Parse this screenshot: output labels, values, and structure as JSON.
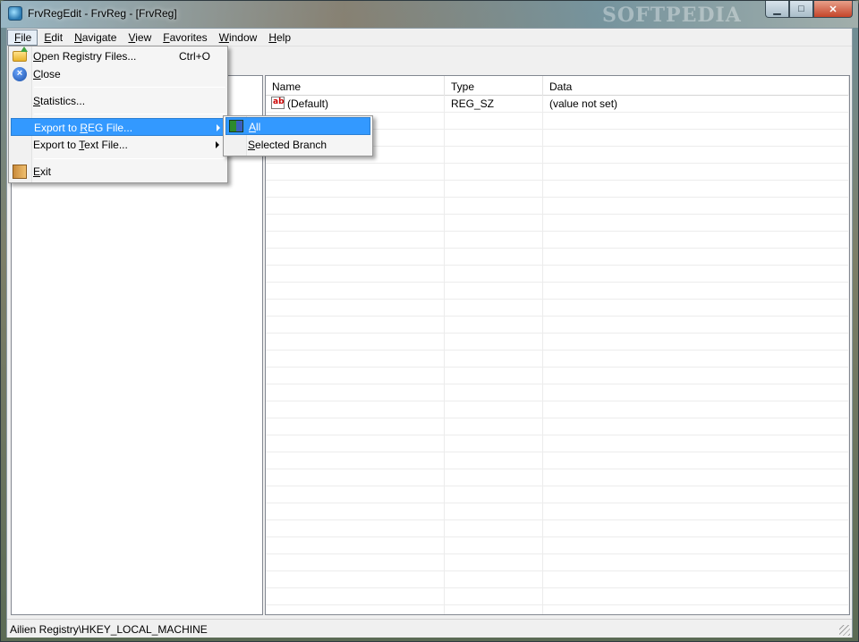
{
  "window": {
    "title": "FrvRegEdit - FrvReg - [FrvReg]",
    "watermark": "SOFTPEDIA",
    "minimize_glyph": "▁",
    "maximize_glyph": "□",
    "close_glyph": "✕"
  },
  "menubar": {
    "items": [
      {
        "key": "F",
        "rest": "ile"
      },
      {
        "key": "E",
        "rest": "dit"
      },
      {
        "key": "N",
        "rest": "avigate"
      },
      {
        "key": "V",
        "rest": "iew"
      },
      {
        "key": "F",
        "rest": "avorites"
      },
      {
        "key": "W",
        "rest": "indow"
      },
      {
        "key": "H",
        "rest": "elp"
      }
    ]
  },
  "file_menu": {
    "open_key": "O",
    "open_rest": "pen Registry Files...",
    "open_shortcut": "Ctrl+O",
    "close_key": "C",
    "close_rest": "lose",
    "statistics_key": "S",
    "statistics_rest": "tatistics...",
    "export_reg_pre": "Export to ",
    "export_reg_key": "R",
    "export_reg_rest": "EG File...",
    "export_text_pre": "Export to ",
    "export_text_key": "T",
    "export_text_rest": "ext File...",
    "exit_key": "E",
    "exit_rest": "xit"
  },
  "submenu": {
    "all_key": "A",
    "all_rest": "ll",
    "branch_key": "S",
    "branch_rest": "elected Branch"
  },
  "list": {
    "columns": [
      "Name",
      "Type",
      "Data"
    ],
    "rows": [
      {
        "name": "(Default)",
        "type": "REG_SZ",
        "data": "(value not set)",
        "icon": "ab"
      }
    ]
  },
  "status": {
    "path": "Ailien Registry\\HKEY_LOCAL_MACHINE"
  }
}
